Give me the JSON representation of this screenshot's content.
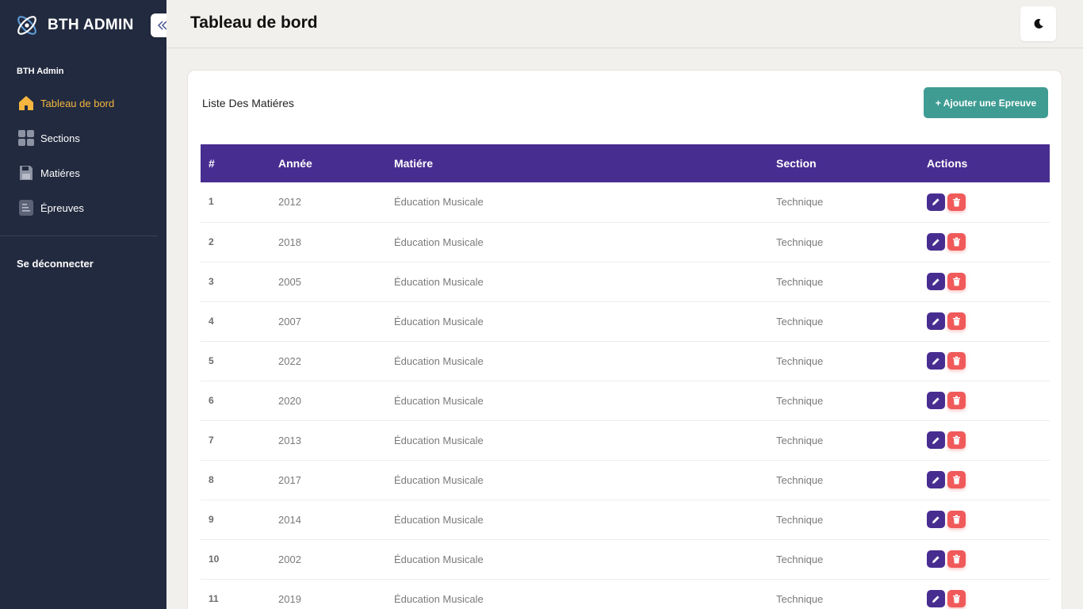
{
  "brand": {
    "name": "BTH ADMIN"
  },
  "sidebar": {
    "section_label": "BTH Admin",
    "items": [
      {
        "label": "Tableau de bord",
        "icon": "home-icon",
        "active": true
      },
      {
        "label": "Sections",
        "icon": "grid-icon",
        "active": false
      },
      {
        "label": "Matiéres",
        "icon": "save-icon",
        "active": false
      },
      {
        "label": "Épreuves",
        "icon": "document-icon",
        "active": false
      }
    ],
    "logout_label": "Se déconnecter"
  },
  "header": {
    "title": "Tableau de bord"
  },
  "card": {
    "title": "Liste Des Matiéres",
    "add_button": "+ Ajouter une Epreuve"
  },
  "table": {
    "columns": [
      "#",
      "Année",
      "Matiére",
      "Section",
      "Actions"
    ],
    "rows": [
      {
        "id": "1",
        "annee": "2012",
        "matiere": "Éducation Musicale",
        "section": "Technique"
      },
      {
        "id": "2",
        "annee": "2018",
        "matiere": "Éducation Musicale",
        "section": "Technique"
      },
      {
        "id": "3",
        "annee": "2005",
        "matiere": "Éducation Musicale",
        "section": "Technique"
      },
      {
        "id": "4",
        "annee": "2007",
        "matiere": "Éducation Musicale",
        "section": "Technique"
      },
      {
        "id": "5",
        "annee": "2022",
        "matiere": "Éducation Musicale",
        "section": "Technique"
      },
      {
        "id": "6",
        "annee": "2020",
        "matiere": "Éducation Musicale",
        "section": "Technique"
      },
      {
        "id": "7",
        "annee": "2013",
        "matiere": "Éducation Musicale",
        "section": "Technique"
      },
      {
        "id": "8",
        "annee": "2017",
        "matiere": "Éducation Musicale",
        "section": "Technique"
      },
      {
        "id": "9",
        "annee": "2014",
        "matiere": "Éducation Musicale",
        "section": "Technique"
      },
      {
        "id": "10",
        "annee": "2002",
        "matiere": "Éducation Musicale",
        "section": "Technique"
      },
      {
        "id": "11",
        "annee": "2019",
        "matiere": "Éducation Musicale",
        "section": "Technique"
      }
    ]
  },
  "colors": {
    "sidebar_bg": "#222a3f",
    "accent_active": "#f4b63f",
    "table_header": "#482d91",
    "add_button": "#3f9c93",
    "delete": "#f05a5a"
  }
}
